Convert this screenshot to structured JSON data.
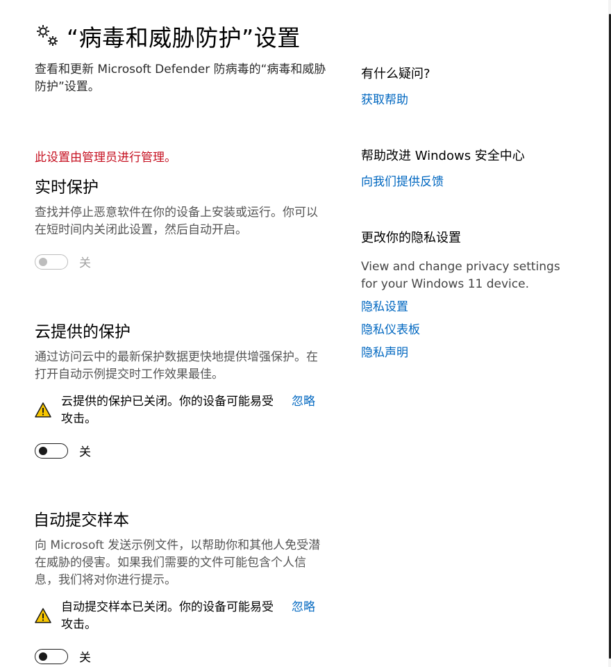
{
  "header": {
    "title": "“病毒和威胁防护”设置",
    "icon": "gears-icon"
  },
  "intro": "查看和更新 Microsoft Defender 防病毒的“病毒和威胁防护”设置。",
  "admin_note": "此设置由管理员进行管理。",
  "colors": {
    "link": "#0067c0",
    "admin_note": "#c50f1f",
    "warning": "#f7c600"
  },
  "realtime": {
    "title": "实时保护",
    "description": "查找并停止恶意软件在你的设备上安装或运行。你可以在短时间内关闭此设置，然后自动开启。",
    "toggle_state": "关",
    "disabled": true
  },
  "cloud": {
    "title": "云提供的保护",
    "description": "通过访问云中的最新保护数据更快地提供增强保护。在打开自动示例提交时工作效果最佳。",
    "warning": "云提供的保护已关闭。你的设备可能易受攻击。",
    "ignore_label": "忽略",
    "toggle_state": "关"
  },
  "sample": {
    "title": "自动提交样本",
    "description": "向 Microsoft 发送示例文件，以帮助你和其他人免受潜在威胁的侵害。如果我们需要的文件可能包含个人信息，我们将对你进行提示。",
    "warning": "自动提交样本已关闭。你的设备可能易受攻击。",
    "ignore_label": "忽略",
    "toggle_state": "关"
  },
  "sidebar": {
    "help": {
      "heading": "有什么疑问?",
      "link": "获取帮助"
    },
    "improve": {
      "heading": "帮助改进 Windows 安全中心",
      "link": "向我们提供反馈"
    },
    "privacy": {
      "heading": "更改你的隐私设置",
      "text": "View and change privacy settings for your Windows 11 device.",
      "links": [
        "隐私设置",
        "隐私仪表板",
        "隐私声明"
      ]
    }
  }
}
